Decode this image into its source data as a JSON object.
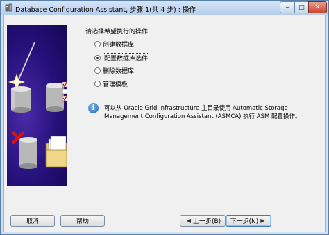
{
  "window": {
    "title": "Database Configuration Assistant, 步骤 1(共 4 步) : 操作"
  },
  "main": {
    "prompt": "请选择希望执行的操作:",
    "options": [
      {
        "label": "创建数据库",
        "selected": false
      },
      {
        "label": "配置数据库选件",
        "selected": true
      },
      {
        "label": "删除数据库",
        "selected": false
      },
      {
        "label": "管理模板",
        "selected": false
      }
    ],
    "info_text": "可以从 Oracle Grid Infrastructure 主目录使用 Automatic Storage Management Configuration Assistant (ASMCA) 执行 ASM 配置操作。"
  },
  "buttons": {
    "cancel": "取消",
    "help": "帮助",
    "back": "上一步(B)",
    "next": "下一步(N)"
  },
  "icons": [
    "app-icon",
    "minimize-icon",
    "maximize-icon",
    "close-icon",
    "info-icon",
    "back-arrow-icon",
    "next-arrow-icon"
  ],
  "colors": {
    "title_bar": "#c7daf0",
    "illustration_bg": "#25107a",
    "info_icon": "#1f63b4",
    "default_button_border": "#3b79c9"
  }
}
